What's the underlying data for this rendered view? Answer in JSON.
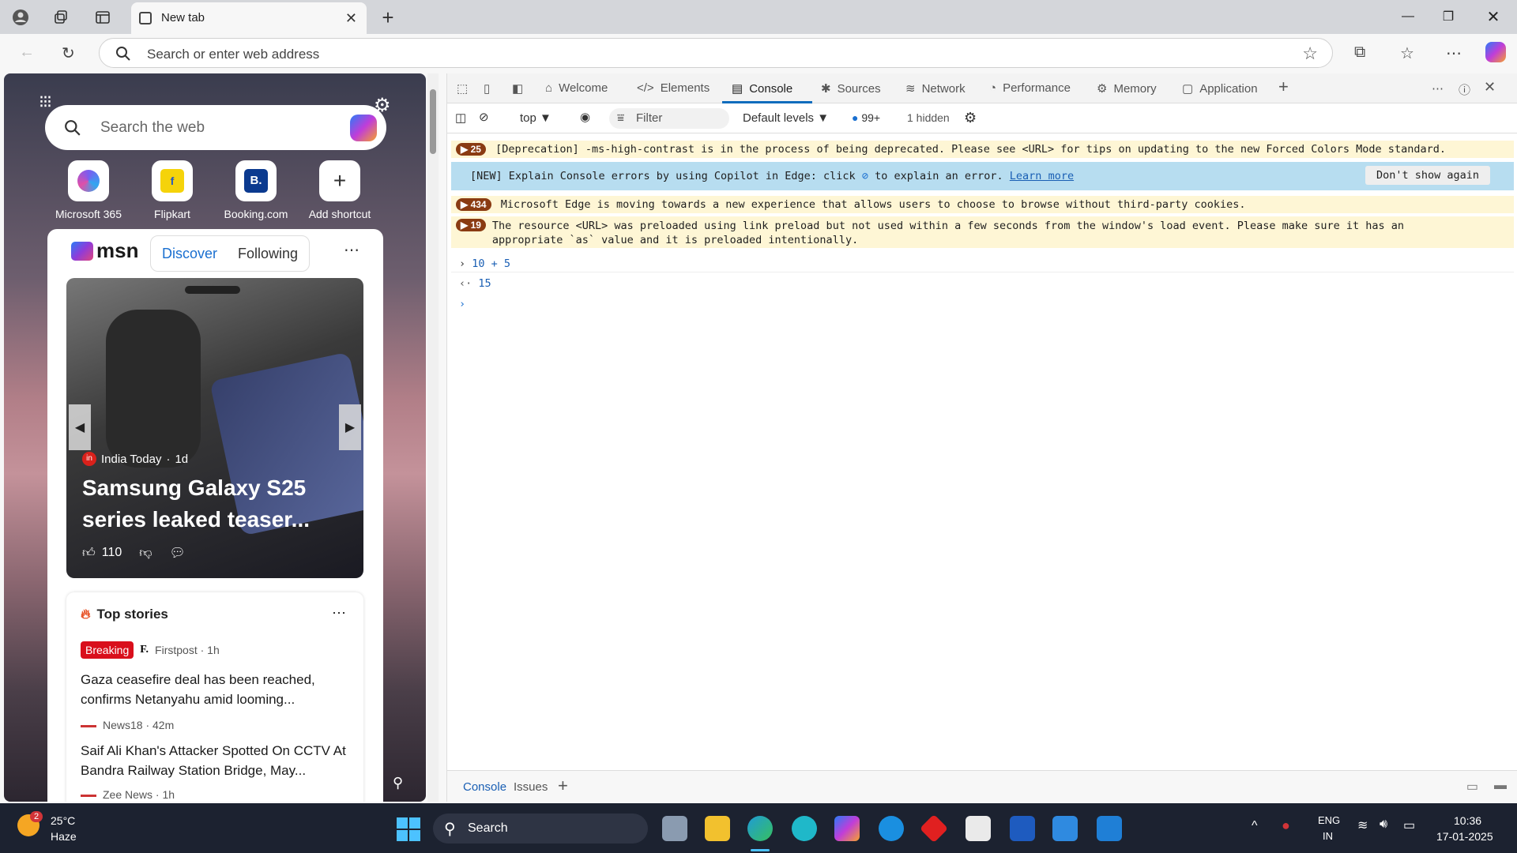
{
  "browser": {
    "tab_title": "New tab",
    "address_placeholder": "Search or enter web address"
  },
  "newtab": {
    "search_placeholder": "Search the web",
    "shortcuts": [
      {
        "label": "Microsoft 365"
      },
      {
        "label": "Flipkart"
      },
      {
        "label": "Booking.com"
      },
      {
        "label": "Add shortcut"
      }
    ],
    "msn": {
      "brand": "msn",
      "tabs": [
        "Discover",
        "Following"
      ],
      "hero": {
        "source": "India Today",
        "age": "1d",
        "headline": "Samsung Galaxy S25 series leaked teaser...",
        "likes": "110"
      },
      "top_stories": {
        "title": "Top stories",
        "items": [
          {
            "badge": "Breaking",
            "source": "Firstpost · 1h",
            "headline": "Gaza ceasefire deal has been reached, confirms Netanyahu amid looming..."
          },
          {
            "badge": "",
            "source": "News18 · 42m",
            "headline": "Saif Ali Khan's Attacker Spotted On CCTV At Bandra Railway Station Bridge, May..."
          },
          {
            "badge": "",
            "source": "Zee News · 1h",
            "headline": ""
          }
        ]
      }
    }
  },
  "devtools": {
    "tabs": [
      "Welcome",
      "Elements",
      "Console",
      "Sources",
      "Network",
      "Performance",
      "Memory",
      "Application"
    ],
    "toolbar": {
      "context": "top",
      "filter_placeholder": "Filter",
      "levels": "Default levels",
      "issues_count": "99+",
      "hidden": "1 hidden"
    },
    "messages": [
      {
        "count": "25",
        "text": "[Deprecation] -ms-high-contrast is in the process of being deprecated. Please see <URL> for tips on updating to the new Forced Colors Mode standard."
      },
      {
        "count": "",
        "text": "[NEW] Explain Console errors by using Copilot in Edge: click",
        "text2": "to explain an error.",
        "link": "Learn more",
        "button": "Don't show again"
      },
      {
        "count": "434",
        "text": "Microsoft Edge is moving towards a new experience that allows users to choose to browse without third-party cookies."
      },
      {
        "count": "19",
        "text": "The resource <URL> was preloaded using link preload but not used within a few seconds from the window's load event. Please make sure it has an appropriate `as` value and it is preloaded intentionally."
      }
    ],
    "console_input": "10 + 5",
    "console_result": "15",
    "bottom_tabs": [
      "Console",
      "Issues"
    ]
  },
  "taskbar": {
    "weather_temp": "25°C",
    "weather_desc": "Haze",
    "weather_badge": "2",
    "search_label": "Search",
    "lang1": "ENG",
    "lang2": "IN",
    "time": "10:36",
    "date": "17-01-2025"
  }
}
